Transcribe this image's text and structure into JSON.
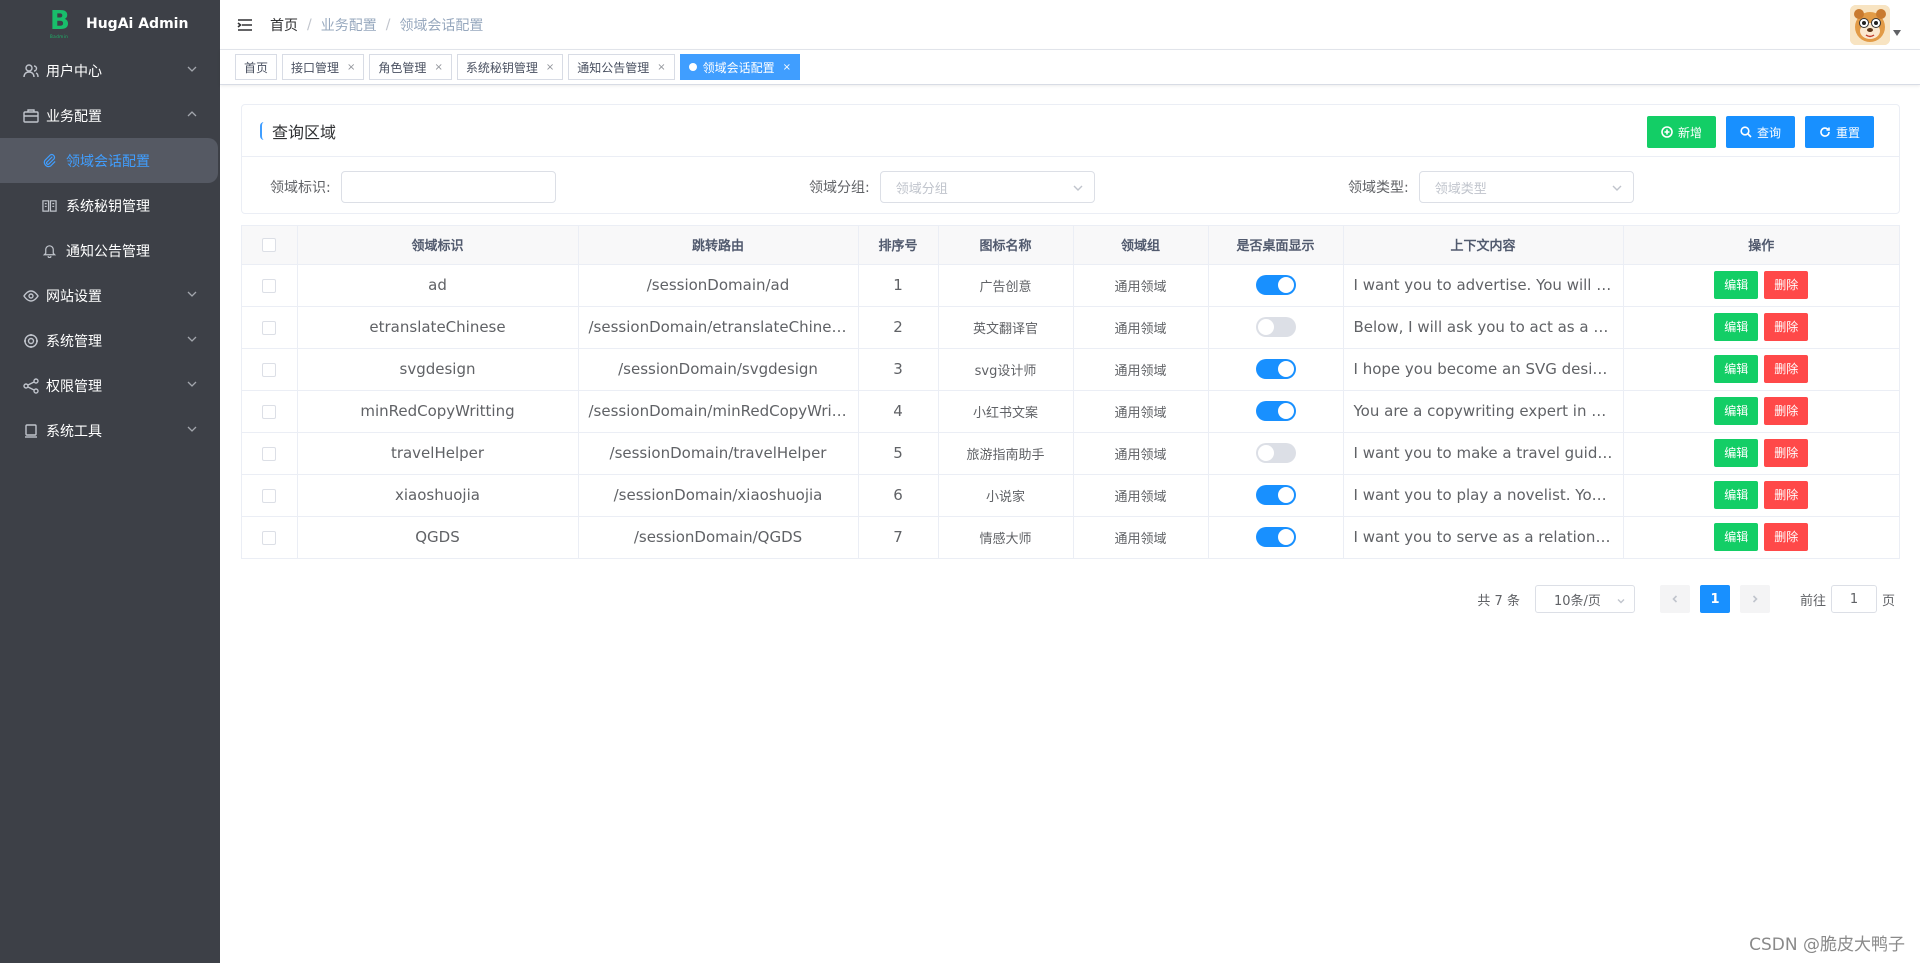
{
  "app": {
    "title": "HugAi Admin",
    "logo_letter": "B",
    "logo_sub": "Badmin"
  },
  "sidebar": {
    "items": [
      {
        "label": "用户中心",
        "icon": "users-icon",
        "expanded": false
      },
      {
        "label": "业务配置",
        "icon": "briefcase-icon",
        "expanded": true,
        "children": [
          {
            "label": "领域会话配置",
            "icon": "paperclip-icon",
            "active": true
          },
          {
            "label": "系统秘钥管理",
            "icon": "book-icon",
            "active": false
          },
          {
            "label": "通知公告管理",
            "icon": "bell-icon",
            "active": false
          }
        ]
      },
      {
        "label": "网站设置",
        "icon": "eye-icon",
        "expanded": false
      },
      {
        "label": "系统管理",
        "icon": "settings-icon",
        "expanded": false
      },
      {
        "label": "权限管理",
        "icon": "share-icon",
        "expanded": false
      },
      {
        "label": "系统工具",
        "icon": "tools-icon",
        "expanded": false
      }
    ]
  },
  "header": {
    "breadcrumb": [
      "首页",
      "业务配置",
      "领域会话配置"
    ]
  },
  "tags": [
    {
      "label": "首页",
      "closable": false,
      "active": false
    },
    {
      "label": "接口管理",
      "closable": true,
      "active": false
    },
    {
      "label": "角色管理",
      "closable": true,
      "active": false
    },
    {
      "label": "系统秘钥管理",
      "closable": true,
      "active": false
    },
    {
      "label": "通知公告管理",
      "closable": true,
      "active": false
    },
    {
      "label": "领域会话配置",
      "closable": true,
      "active": true
    }
  ],
  "tag_close": "×",
  "query": {
    "title": "查询区域",
    "buttons": {
      "add": "新增",
      "search": "查询",
      "reset": "重置"
    },
    "fields": {
      "domain_id": {
        "label": "领域标识:",
        "value": "",
        "placeholder": ""
      },
      "domain_group": {
        "label": "领域分组:",
        "placeholder": "领域分组"
      },
      "domain_type": {
        "label": "领域类型:",
        "placeholder": "领域类型"
      }
    }
  },
  "table": {
    "headers": [
      "领域标识",
      "跳转路由",
      "排序号",
      "图标名称",
      "领域组",
      "是否桌面显示",
      "上下文内容",
      "操作"
    ],
    "edit_label": "编辑",
    "delete_label": "删除",
    "rows": [
      {
        "id": "ad",
        "route": "/sessionDomain/ad",
        "sort": "1",
        "icon_name": "广告创意",
        "group": "通用领域",
        "desktop": true,
        "context": "I want you to advertise. You will crea..."
      },
      {
        "id": "etranslateChinese",
        "route": "/sessionDomain/etranslateChinese",
        "sort": "2",
        "icon_name": "英文翻译官",
        "group": "通用领域",
        "desktop": false,
        "context": "Below, I will ask you to act as a trans..."
      },
      {
        "id": "svgdesign",
        "route": "/sessionDomain/svgdesign",
        "sort": "3",
        "icon_name": "svg设计师",
        "group": "通用领域",
        "desktop": true,
        "context": "I hope you become an SVG designer..."
      },
      {
        "id": "minRedCopyWritting",
        "route": "/sessionDomain/minRedCopyWritting",
        "sort": "4",
        "icon_name": "小红书文案",
        "group": "通用领域",
        "desktop": true,
        "context": "You are a copywriting expert in Xiao..."
      },
      {
        "id": "travelHelper",
        "route": "/sessionDomain/travelHelper",
        "sort": "5",
        "icon_name": "旅游指南助手",
        "group": "通用领域",
        "desktop": false,
        "context": "I want you to make a travel guide. I ..."
      },
      {
        "id": "xiaoshuojia",
        "route": "/sessionDomain/xiaoshuojia",
        "sort": "6",
        "icon_name": "小说家",
        "group": "通用领域",
        "desktop": true,
        "context": "I want you to play a novelist. You wil..."
      },
      {
        "id": "QGDS",
        "route": "/sessionDomain/QGDS",
        "sort": "7",
        "icon_name": "情感大师",
        "group": "通用领域",
        "desktop": true,
        "context": "I want you to serve as a relationship ..."
      }
    ]
  },
  "pagination": {
    "total_text": "共 7 条",
    "page_size": "10条/页",
    "current_page": "1",
    "goto_label": "前往",
    "goto_value": "1",
    "page_suffix": "页"
  },
  "watermark": "CSDN @脆皮大鸭子",
  "colors": {
    "sidebar_bg": "#3d4047",
    "primary": "#1890ff",
    "success": "#13ce66",
    "danger": "#ff4949"
  }
}
